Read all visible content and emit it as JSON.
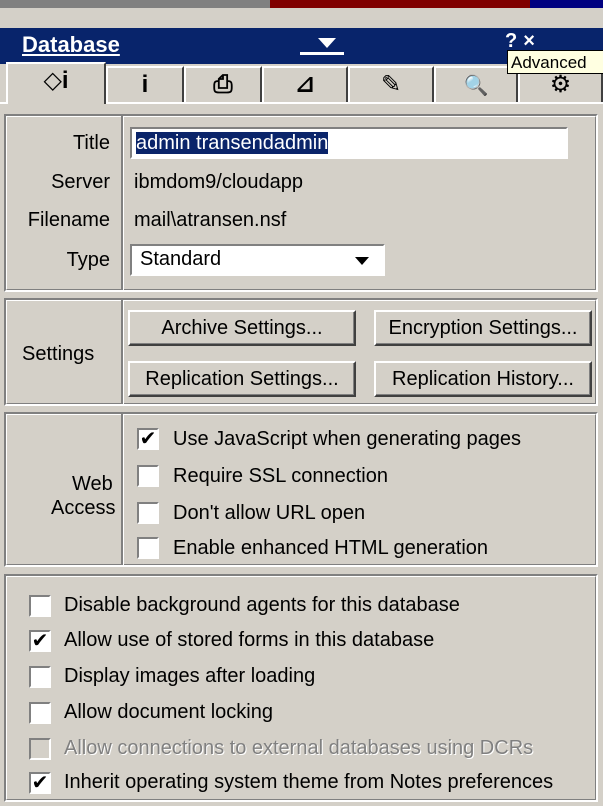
{
  "window": {
    "title": "Database",
    "tooltip": "Advanced",
    "toolbar_glyphs": "?×"
  },
  "tabs": [
    {
      "name": "basics",
      "glyph": "◇i"
    },
    {
      "name": "info",
      "glyph": "i"
    },
    {
      "name": "printing",
      "glyph": "⎙"
    },
    {
      "name": "design",
      "glyph": "⊿"
    },
    {
      "name": "launch",
      "glyph": "✎"
    },
    {
      "name": "full-text",
      "glyph": "🔍"
    },
    {
      "name": "advanced",
      "glyph": "⚙"
    }
  ],
  "basics": {
    "title_label": "Title",
    "title_value": "admin transendadmin",
    "server_label": "Server",
    "server_value": "ibmdom9/cloudapp",
    "filename_label": "Filename",
    "filename_value": "mail\\atransen.nsf",
    "type_label": "Type",
    "type_value": "Standard"
  },
  "settings": {
    "label": "Settings",
    "archive": "Archive Settings...",
    "encryption": "Encryption Settings...",
    "replication": "Replication Settings...",
    "replication_history": "Replication History..."
  },
  "web_access": {
    "label_line1": "Web",
    "label_line2": "Access",
    "options": [
      {
        "label": "Use JavaScript when generating pages",
        "checked": true
      },
      {
        "label": "Require SSL connection",
        "checked": false
      },
      {
        "label": "Don't allow URL open",
        "checked": false
      },
      {
        "label": "Enable enhanced HTML generation",
        "checked": false
      }
    ]
  },
  "options": [
    {
      "label": "Disable background agents for this database",
      "checked": false,
      "disabled": false
    },
    {
      "label": "Allow use of stored forms in this database",
      "checked": true,
      "disabled": false
    },
    {
      "label": "Display images after loading",
      "checked": false,
      "disabled": false
    },
    {
      "label": "Allow document locking",
      "checked": false,
      "disabled": false
    },
    {
      "label": "Allow connections to external databases using DCRs",
      "checked": false,
      "disabled": true
    },
    {
      "label": "Inherit operating system theme from Notes preferences",
      "checked": true,
      "disabled": false
    }
  ],
  "check_glyph": "✔"
}
